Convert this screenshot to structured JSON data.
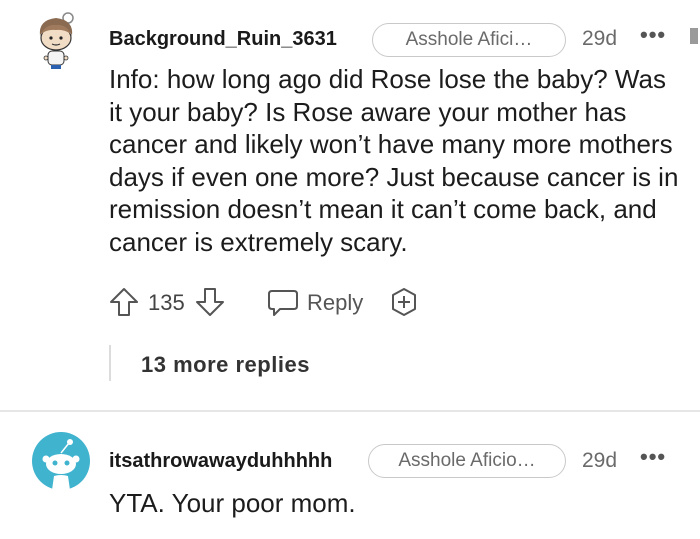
{
  "comments": [
    {
      "username": "Background_Ruin_3631",
      "flair": "Asshole Afici…",
      "age": "29d",
      "more_icon": "more-dots-icon",
      "body": "Info: how long ago did Rose lose the baby? Was it your baby? Is Rose aware your mother has cancer and likely won’t have many more mothers days if even one more? Just because cancer is in remission doesn’t mean it can’t come back, and cancer is extremely scary.",
      "score": "135",
      "reply_label": "Reply",
      "more_replies": "13 more replies"
    },
    {
      "username": "itsathrowawayduhhhhh",
      "flair": "Asshole Aficio…",
      "age": "29d",
      "more_icon": "more-dots-icon",
      "body": "YTA. Your poor mom."
    }
  ],
  "colors": {
    "avatar2_bg": "#40b3cf",
    "text": "#1c1c1c",
    "meta": "#6a6a6a"
  }
}
